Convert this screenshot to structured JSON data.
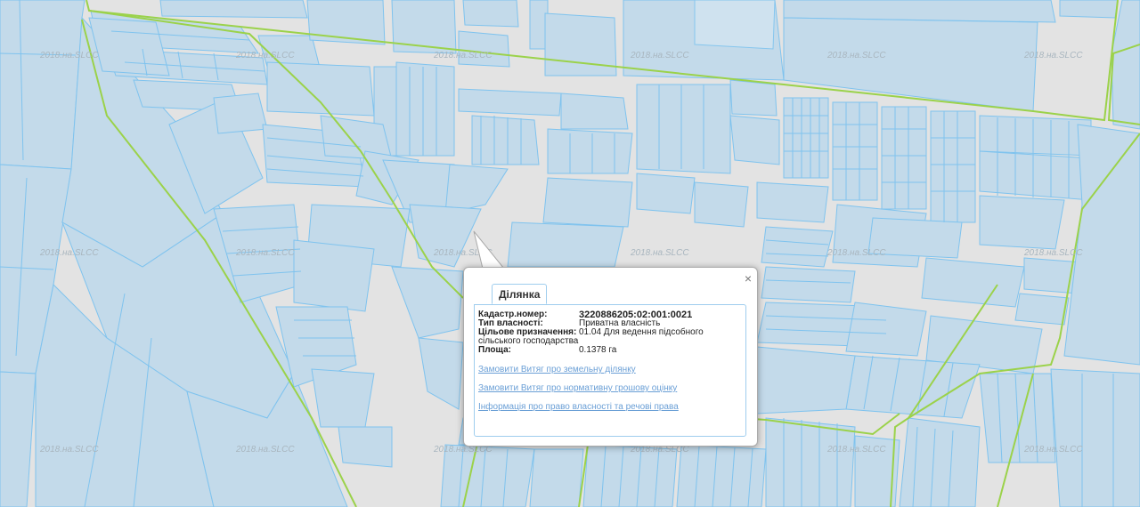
{
  "map": {
    "watermark_text": "2018.на.SLCC",
    "colors": {
      "background": "#e3e3e3",
      "parcel_fill": "#c3daea",
      "parcel_stroke": "#7fc3ee",
      "boundary": "#9bd24a"
    }
  },
  "popup": {
    "tab_label": "Ділянка",
    "close_icon": "×",
    "fields": [
      {
        "label": "Кадастр.номер:",
        "value": "3220886205:02:001:0021",
        "bold": true
      },
      {
        "label": "Тип власності:",
        "value": "Приватна власність"
      },
      {
        "label": "Цільове призначення:",
        "value": "01.04 Для ведення підсобного",
        "value_cont": "сільського господарства"
      },
      {
        "label": "Площа:",
        "value": "0.1378 га"
      }
    ],
    "links": [
      "Замовити Витяг про земельну ділянку",
      "Замовити Витяг про нормативну грошову оцінку",
      "Інформація про право власності та речові права"
    ]
  }
}
